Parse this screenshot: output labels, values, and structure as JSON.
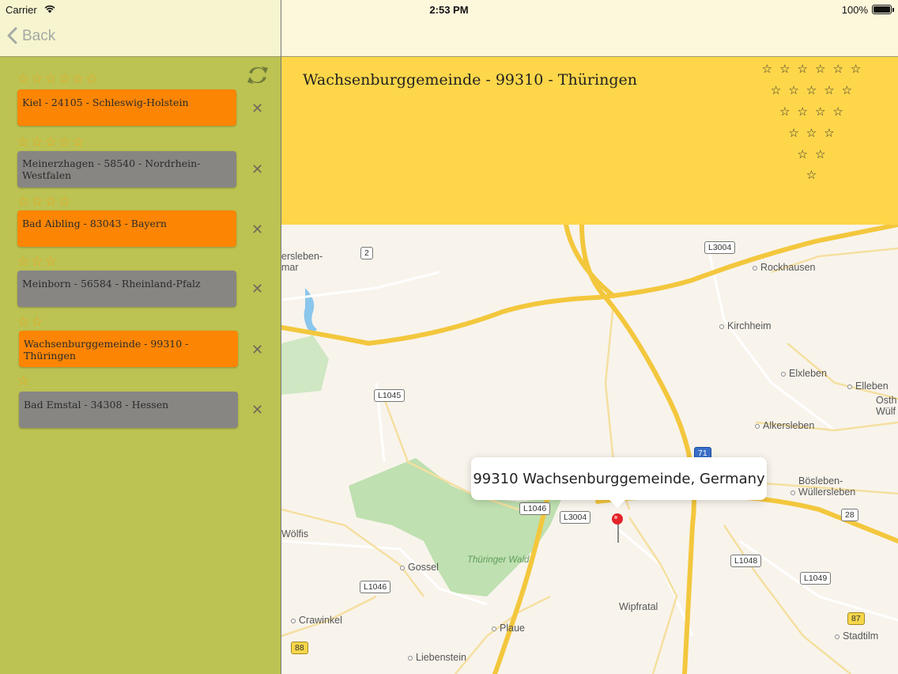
{
  "status_bar": {
    "carrier": "Carrier",
    "time": "2:53 PM",
    "battery": "100%",
    "battery_level": 1.0
  },
  "nav": {
    "back_label": "Back"
  },
  "sidebar": {
    "entries": [
      {
        "stars": "☆☆☆☆☆☆",
        "rating": 6,
        "label": "Kiel - 24105 - Schleswig-Holstein",
        "color": "#fd8504"
      },
      {
        "stars": "☆☆☆☆☆",
        "rating": 5,
        "label": "Meinerzhagen - 58540 - Nordrhein-Westfalen",
        "color": "#878683"
      },
      {
        "stars": "☆☆☆☆",
        "rating": 4,
        "label": "Bad Aibling - 83043 - Bayern",
        "color": "#fd8504"
      },
      {
        "stars": "☆☆☆",
        "rating": 3,
        "label": "Meinborn - 56584 - Rheinland-Pfalz",
        "color": "#878683"
      },
      {
        "stars": "☆☆",
        "rating": 2,
        "label": "Wachsenburggemeinde - 99310 - Thüringen",
        "color": "#fd8504"
      },
      {
        "stars": "☆",
        "rating": 1,
        "label": "Bad Emstal - 34308 - Hessen",
        "color": "#878683"
      }
    ],
    "delete_glyph": "✕"
  },
  "detail": {
    "title": "Wachsenburggemeinde - 99310 - Thüringen",
    "pyramid_rows": [
      "☆☆☆☆☆☆",
      "☆☆☆☆☆",
      "☆☆☆☆",
      "☆☆☆",
      "☆☆",
      "☆"
    ]
  },
  "map": {
    "callout": "99310 Wachsenburggemeinde, Germany",
    "places": {
      "ersleben": "ersleben-",
      "mar": "mar",
      "rockhausen": "Rockhausen",
      "kirchheim": "Kirchheim",
      "elxleben": "Elxleben",
      "elleben": "Elleben",
      "osth": "Osth",
      "wulf": "Wülf",
      "alkersleben": "Alkersleben",
      "bosleben": "Bösleben-",
      "wullersleben": "Wüllersleben",
      "wolfis": "Wölfis",
      "gossel": "Gossel",
      "thuringer_wald": "Thüringer Wald",
      "crawinkel": "Crawinkel",
      "plaue": "Plaue",
      "wipfratal": "Wipfratal",
      "stadtilm": "Stadtilm",
      "liebenstein": "Liebenstein"
    },
    "roads": {
      "r2": "2",
      "l3004_top": "L3004",
      "l1045": "L1045",
      "a71": "71",
      "l1046_a": "L1046",
      "l3004_mid": "L3004",
      "r28": "28",
      "l1048": "L1048",
      "l1049": "L1049",
      "l1046_b": "L1046",
      "r87": "87",
      "r88": "88"
    }
  }
}
